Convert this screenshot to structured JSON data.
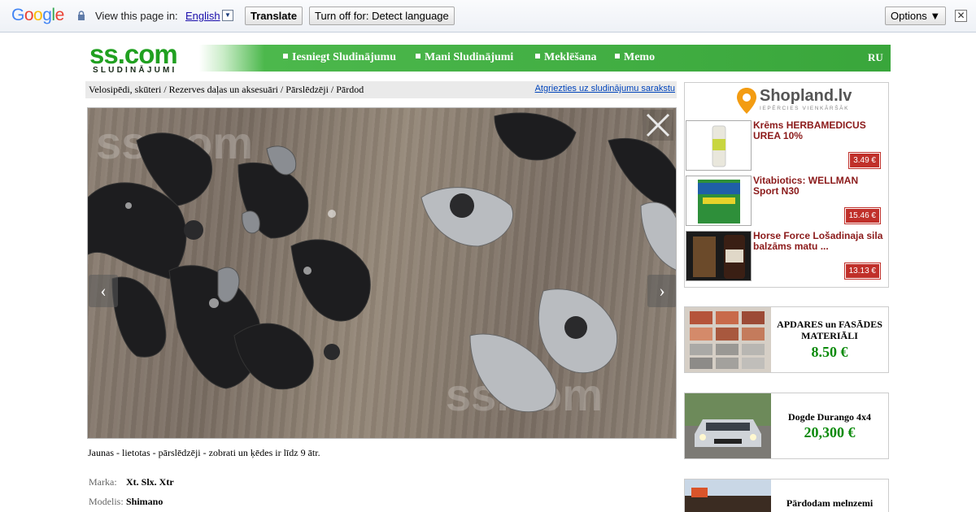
{
  "translate_bar": {
    "logo_letters": [
      "G",
      "o",
      "o",
      "g",
      "l",
      "e"
    ],
    "logo_colors": [
      "#4285f4",
      "#ea4335",
      "#fbbc05",
      "#4285f4",
      "#34a853",
      "#ea4335"
    ],
    "view_label": "View this page in:",
    "language": "English",
    "translate_button": "Translate",
    "turn_off_button": "Turn off for: Detect language",
    "options_button": "Options ▼"
  },
  "site": {
    "logo_main": "ss.com",
    "logo_sub": "SLUDINĀJUMI",
    "nav_items": [
      "Iesniegt Sludinājumu",
      "Mani Sludinājumi",
      "Meklēšana",
      "Memo"
    ],
    "lang_switch": "RU"
  },
  "breadcrumb": {
    "path": "Velosipēdi, skūteri / Rezerves daļas un aksesuāri / Pārslēdzēji / Pārdod",
    "back_link": "Atgriezties uz sludinājumu sarakstu"
  },
  "listing": {
    "watermark": "ss.com",
    "description": "Jaunas - lietotas - pārslēdzēji - zobrati un ķēdes ir līdz 9 ātr.",
    "options": [
      {
        "label": "Marka:",
        "value": "Xt. Slx. Xtr"
      },
      {
        "label": "Modelis:",
        "value": "Shimano"
      }
    ]
  },
  "ads": {
    "shopland": {
      "logo": "Shopland.lv",
      "tagline": "IEPĒRCIES VIENKĀRŠĀK",
      "products": [
        {
          "name": "Krēms HERBAMEDICUS UREA 10%",
          "price": "3.49 €"
        },
        {
          "name": "Vitabiotics: WELLMAN Sport N30",
          "price": "15.46 €"
        },
        {
          "name": "Horse Force Lošadinaja sila balzāms matu ...",
          "price": "13.13 €"
        }
      ]
    },
    "tiles": {
      "title": "APDARES un FASĀDES MATERIĀLI",
      "price": "8.50 €"
    },
    "car": {
      "title": "Dogde Durango 4x4",
      "price": "20,300 €"
    },
    "soil": {
      "title": "Pārdodam melnzemi"
    }
  }
}
